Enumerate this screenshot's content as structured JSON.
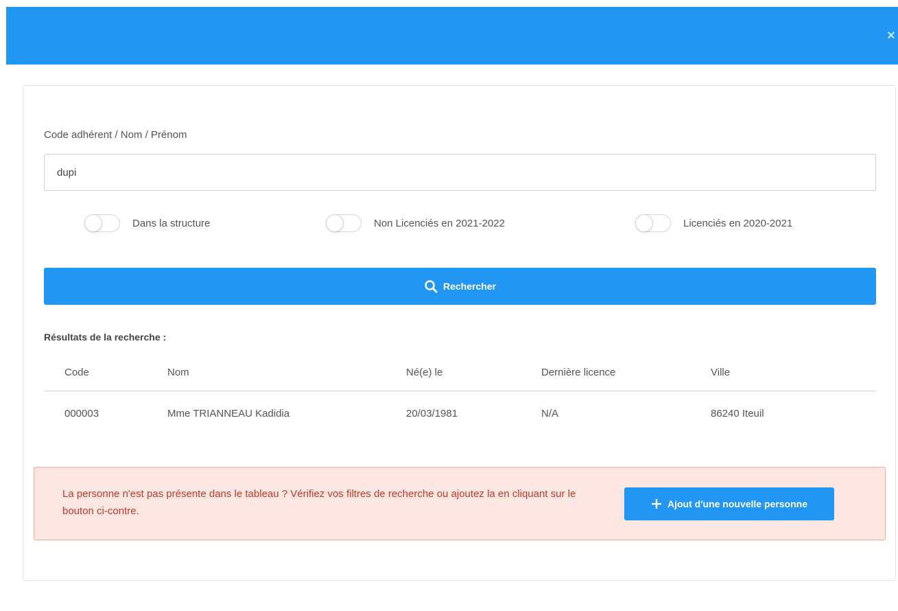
{
  "header": {
    "close_label": "×"
  },
  "search": {
    "label": "Code adhérent / Nom / Prénom",
    "value": "dupi",
    "placeholder": ""
  },
  "filters": [
    {
      "label": "Dans la structure",
      "checked": false
    },
    {
      "label": "Non Licenciés en 2021-2022",
      "checked": false
    },
    {
      "label": "Licenciés en 2020-2021",
      "checked": false
    }
  ],
  "search_button": {
    "label": "Rechercher",
    "icon": "search-icon"
  },
  "results": {
    "title": "Résultats de la recherche :",
    "columns": [
      "Code",
      "Nom",
      "Né(e) le",
      "Dernière licence",
      "Ville"
    ],
    "rows": [
      [
        "000003",
        "Mme TRIANNEAU Kadidia",
        "20/03/1981",
        "N/A",
        "86240 Iteuil"
      ]
    ]
  },
  "alert": {
    "text": "La personne n'est pas présente dans le tableau ? Vérifiez vos filtres de recherche ou ajoutez la en cliquant sur le bouton ci-contre.",
    "button_label": "Ajout d'une nouvelle personne",
    "button_icon": "plus-icon"
  },
  "colors": {
    "primary": "#2196f3",
    "alert_bg": "#fde7e2",
    "alert_border": "#f0a898",
    "alert_text": "#c0392b"
  }
}
